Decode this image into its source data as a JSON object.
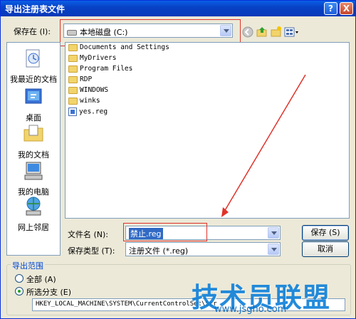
{
  "window": {
    "title": "导出注册表文件",
    "help_label": "?",
    "close_label": "X"
  },
  "save_in": {
    "label": "保存在 (I):",
    "value": "本地磁盘 (C:)"
  },
  "places": [
    {
      "label": "我最近的文档"
    },
    {
      "label": "桌面"
    },
    {
      "label": "我的文档"
    },
    {
      "label": "我的电脑"
    },
    {
      "label": "网上邻居"
    }
  ],
  "files": [
    {
      "name": "Documents and Settings",
      "type": "folder"
    },
    {
      "name": "MyDrivers",
      "type": "folder"
    },
    {
      "name": "Program Files",
      "type": "folder"
    },
    {
      "name": "RDP",
      "type": "folder"
    },
    {
      "name": "WINDOWS",
      "type": "folder"
    },
    {
      "name": "winks",
      "type": "folder"
    },
    {
      "name": "yes.reg",
      "type": "reg"
    }
  ],
  "filename": {
    "label": "文件名 (N):",
    "value": "禁止.reg"
  },
  "filetype": {
    "label": "保存类型 (T):",
    "value": "注册文件 (*.reg)"
  },
  "buttons": {
    "save": "保存 (S)",
    "cancel": "取消"
  },
  "export_range": {
    "title": "导出范围",
    "all_label": "全部 (A)",
    "branch_label": "所选分支 (E)",
    "branch_value": "HKEY_LOCAL_MACHINE\\SYSTEM\\CurrentControlSet\\Ser"
  },
  "watermark": {
    "main": "技术员联盟",
    "url": "www.jsgho.com"
  },
  "colors": {
    "accent": "#0A5FE6",
    "highlight_box": "#E0322A",
    "selection": "#316AC5"
  }
}
